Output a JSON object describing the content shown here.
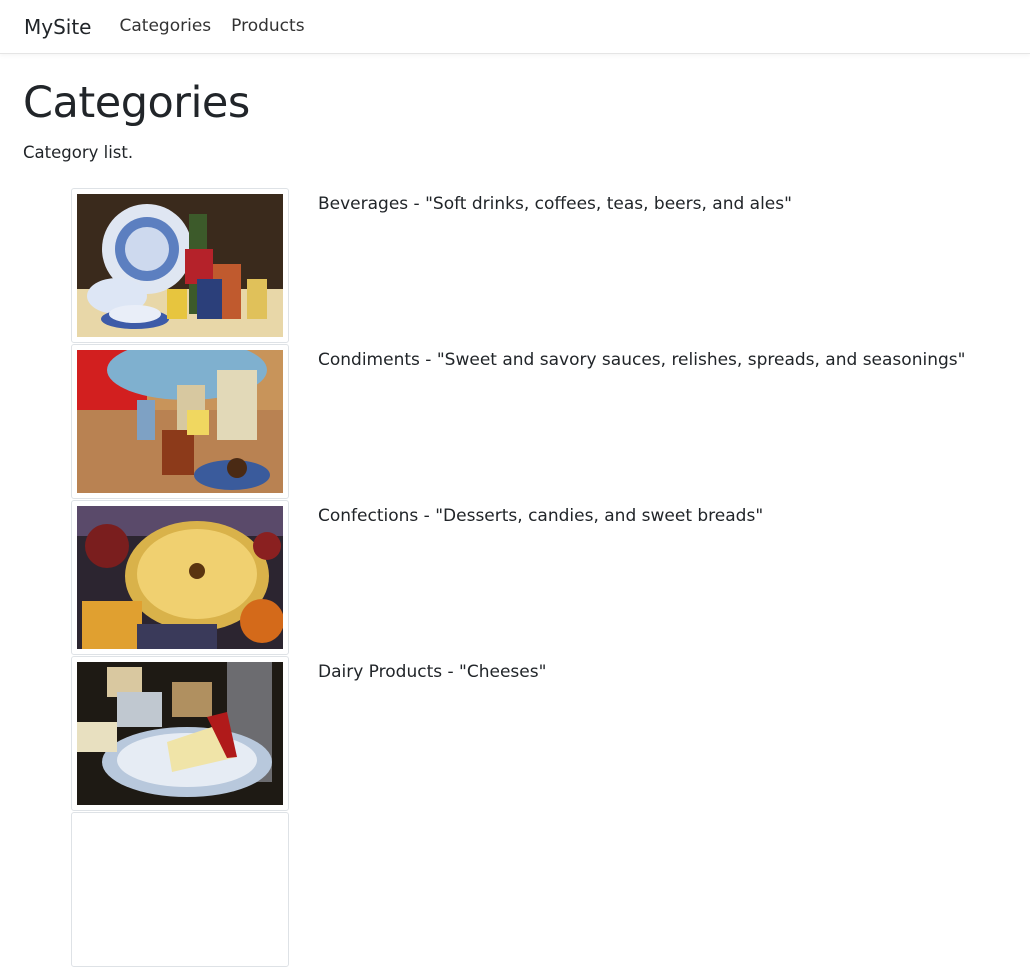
{
  "navbar": {
    "brand": "MySite",
    "links": [
      "Categories",
      "Products"
    ]
  },
  "page": {
    "title": "Categories",
    "subtitle": "Category list."
  },
  "categories": [
    {
      "name": "Beverages",
      "description": "\"Soft drinks, coffees, teas, beers, and ales\"",
      "image_icon": "beverages-photo"
    },
    {
      "name": "Condiments",
      "description": "\"Sweet and savory sauces, relishes, spreads, and seasonings\"",
      "image_icon": "condiments-photo"
    },
    {
      "name": "Confections",
      "description": "\"Desserts, candies, and sweet breads\"",
      "image_icon": "confections-photo"
    },
    {
      "name": "Dairy Products",
      "description": "\"Cheeses\"",
      "image_icon": "dairy-products-photo"
    }
  ]
}
